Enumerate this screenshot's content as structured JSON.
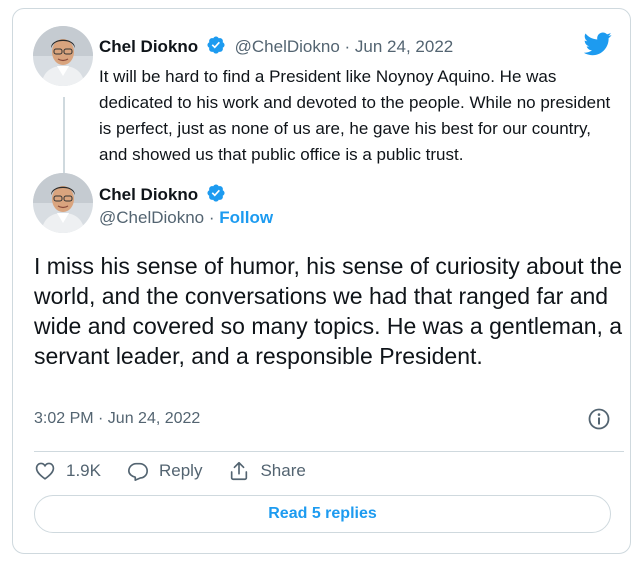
{
  "quoted_tweet": {
    "author_name": "Chel Diokno",
    "handle": "@ChelDiokno",
    "separator": "·",
    "date": "Jun 24, 2022",
    "text": "It will be hard to find a President like Noynoy Aquino. He was dedicated to his work and devoted to the people. While no president is perfect, just as none of us are, he gave his best for our country, and showed us that public office is a public trust."
  },
  "main_tweet": {
    "author_name": "Chel Diokno",
    "handle": "@ChelDiokno",
    "separator": "·",
    "follow_label": "Follow",
    "text": "I miss his sense of humor, his sense of curiosity about the world, and the conversations we had that ranged far and wide and covered so many topics. He was a gentleman, a servant leader, and a responsible President.",
    "timestamp": "3:02 PM · Jun 24, 2022"
  },
  "actions": {
    "like_count": "1.9K",
    "reply_label": "Reply",
    "share_label": "Share"
  },
  "read_replies_label": "Read 5 replies",
  "icons": [
    "twitter-bird-icon",
    "verified-badge-icon",
    "info-icon",
    "heart-icon",
    "reply-icon",
    "share-icon"
  ],
  "colors": {
    "accent": "#1d9bf0",
    "text": "#0f1419",
    "muted": "#536471",
    "border": "#cfd9de"
  }
}
